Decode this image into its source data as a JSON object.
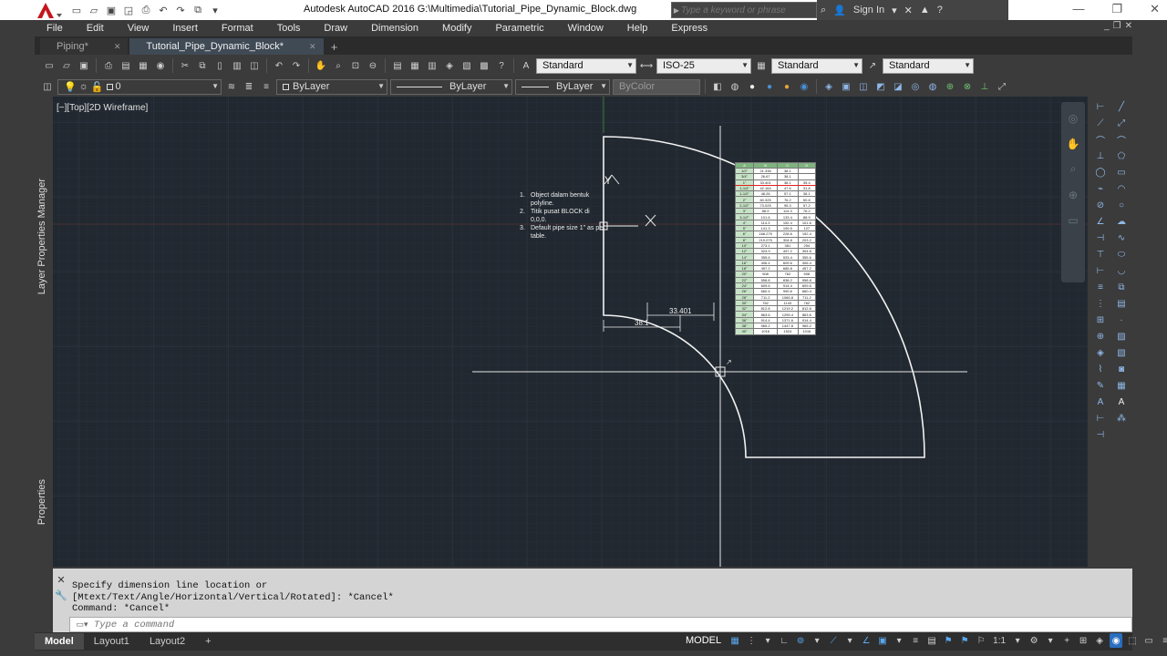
{
  "window": {
    "title": "Autodesk AutoCAD 2016    G:\\Multimedia\\Tutorial_Pipe_Dynamic_Block.dwg",
    "search_placeholder": "Type a keyword or phrase",
    "sign_in": "Sign In",
    "logo_letter": "A"
  },
  "menu": {
    "items": [
      "File",
      "Edit",
      "View",
      "Insert",
      "Format",
      "Tools",
      "Draw",
      "Dimension",
      "Modify",
      "Parametric",
      "Window",
      "Help",
      "Express"
    ]
  },
  "doc_tabs": [
    {
      "label": "Piping*",
      "active": false
    },
    {
      "label": "Tutorial_Pipe_Dynamic_Block*",
      "active": true
    }
  ],
  "toolbar1": {
    "text_style": "Standard",
    "dim_style": "ISO-25",
    "table_style": "Standard",
    "mleader_style": "Standard"
  },
  "toolbar2": {
    "layer": "0",
    "color": "ByLayer",
    "linetype": "ByLayer",
    "lineweight": "ByLayer",
    "plot_style": "ByColor"
  },
  "palettes": {
    "layer_manager": "Layer Properties Manager",
    "properties": "Properties"
  },
  "viewport": {
    "label": "[−][Top][2D Wireframe]"
  },
  "drawing": {
    "notes": [
      {
        "num": "1.",
        "text": "Object dalam bentuk polyline."
      },
      {
        "num": "2.",
        "text": "Titik pusat BLOCK di 0,0,0."
      },
      {
        "num": "3.",
        "text": "Default pipe size 1\" as per table."
      }
    ],
    "dimension_1": "33.401",
    "dimension_2": "38.1",
    "ucs_y": "Y",
    "pipe_table": {
      "header": [
        "A",
        "B",
        "C",
        "D"
      ],
      "selected_row": 3,
      "rows": [
        [
          "1/2\"",
          "21.336",
          "38.1",
          ""
        ],
        [
          "3/4\"",
          "26.67",
          "38.1",
          ""
        ],
        [
          "1\"",
          "33.401",
          "38.1",
          "35.4"
        ],
        [
          "1-1/4\"",
          "42.164",
          "47.6",
          "31.8"
        ],
        [
          "1-1/2\"",
          "48.26",
          "57.1",
          "38.1"
        ],
        [
          "2\"",
          "60.325",
          "76.2",
          "50.8"
        ],
        [
          "2-1/2\"",
          "73.025",
          "95.3",
          "57.2"
        ],
        [
          "3\"",
          "88.9",
          "114.3",
          "76.2"
        ],
        [
          "3-1/2\"",
          "101.6",
          "133.4",
          "88.9"
        ],
        [
          "4\"",
          "114.3",
          "152.4",
          "101.6"
        ],
        [
          "5\"",
          "141.3",
          "190.5",
          "127"
        ],
        [
          "6\"",
          "168.275",
          "228.6",
          "152.4"
        ],
        [
          "8\"",
          "219.075",
          "304.8",
          "203.2"
        ],
        [
          "10\"",
          "273.1",
          "381",
          "254"
        ],
        [
          "12\"",
          "323.9",
          "457.2",
          "304.8"
        ],
        [
          "14\"",
          "355.6",
          "533.4",
          "355.6"
        ],
        [
          "16\"",
          "406.4",
          "609.6",
          "406.4"
        ],
        [
          "18\"",
          "457.2",
          "685.8",
          "457.2"
        ],
        [
          "20\"",
          "508",
          "762",
          "508"
        ],
        [
          "22\"",
          "558.8",
          "838.2",
          "558.8"
        ],
        [
          "24\"",
          "609.6",
          "914.4",
          "609.6"
        ],
        [
          "26\"",
          "660.4",
          "990.6",
          "660.4"
        ],
        [
          "28\"",
          "711.2",
          "1066.8",
          "711.2"
        ],
        [
          "30\"",
          "762",
          "1143",
          "762"
        ],
        [
          "32\"",
          "812.8",
          "1219.2",
          "812.8"
        ],
        [
          "34\"",
          "863.6",
          "1295.4",
          "863.6"
        ],
        [
          "36\"",
          "914.4",
          "1371.6",
          "914.4"
        ],
        [
          "38\"",
          "965.2",
          "1447.8",
          "965.2"
        ],
        [
          "40\"",
          "1016",
          "1524",
          "1016"
        ]
      ]
    }
  },
  "command": {
    "history": [
      "Specify dimension line location or",
      "[Mtext/Text/Angle/Horizontal/Vertical/Rotated]: *Cancel*",
      "Command: *Cancel*"
    ],
    "placeholder": "Type a command"
  },
  "status": {
    "layout_tabs": [
      {
        "label": "Model",
        "active": true
      },
      {
        "label": "Layout1",
        "active": false
      },
      {
        "label": "Layout2",
        "active": false
      }
    ],
    "model_label": "MODEL",
    "scale": "1:1"
  }
}
